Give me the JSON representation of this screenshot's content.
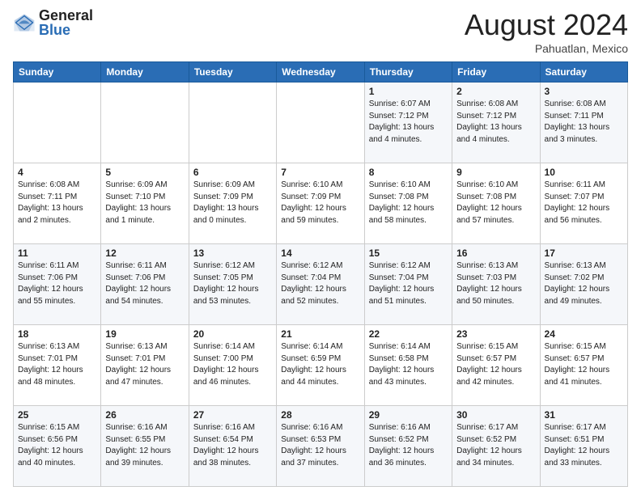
{
  "header": {
    "logo_general": "General",
    "logo_blue": "Blue",
    "main_title": "August 2024",
    "sub_title": "Pahuatlan, Mexico"
  },
  "calendar": {
    "days_of_week": [
      "Sunday",
      "Monday",
      "Tuesday",
      "Wednesday",
      "Thursday",
      "Friday",
      "Saturday"
    ],
    "weeks": [
      [
        {
          "day": "",
          "info": ""
        },
        {
          "day": "",
          "info": ""
        },
        {
          "day": "",
          "info": ""
        },
        {
          "day": "",
          "info": ""
        },
        {
          "day": "1",
          "info": "Sunrise: 6:07 AM\nSunset: 7:12 PM\nDaylight: 13 hours\nand 4 minutes."
        },
        {
          "day": "2",
          "info": "Sunrise: 6:08 AM\nSunset: 7:12 PM\nDaylight: 13 hours\nand 4 minutes."
        },
        {
          "day": "3",
          "info": "Sunrise: 6:08 AM\nSunset: 7:11 PM\nDaylight: 13 hours\nand 3 minutes."
        }
      ],
      [
        {
          "day": "4",
          "info": "Sunrise: 6:08 AM\nSunset: 7:11 PM\nDaylight: 13 hours\nand 2 minutes."
        },
        {
          "day": "5",
          "info": "Sunrise: 6:09 AM\nSunset: 7:10 PM\nDaylight: 13 hours\nand 1 minute."
        },
        {
          "day": "6",
          "info": "Sunrise: 6:09 AM\nSunset: 7:09 PM\nDaylight: 13 hours\nand 0 minutes."
        },
        {
          "day": "7",
          "info": "Sunrise: 6:10 AM\nSunset: 7:09 PM\nDaylight: 12 hours\nand 59 minutes."
        },
        {
          "day": "8",
          "info": "Sunrise: 6:10 AM\nSunset: 7:08 PM\nDaylight: 12 hours\nand 58 minutes."
        },
        {
          "day": "9",
          "info": "Sunrise: 6:10 AM\nSunset: 7:08 PM\nDaylight: 12 hours\nand 57 minutes."
        },
        {
          "day": "10",
          "info": "Sunrise: 6:11 AM\nSunset: 7:07 PM\nDaylight: 12 hours\nand 56 minutes."
        }
      ],
      [
        {
          "day": "11",
          "info": "Sunrise: 6:11 AM\nSunset: 7:06 PM\nDaylight: 12 hours\nand 55 minutes."
        },
        {
          "day": "12",
          "info": "Sunrise: 6:11 AM\nSunset: 7:06 PM\nDaylight: 12 hours\nand 54 minutes."
        },
        {
          "day": "13",
          "info": "Sunrise: 6:12 AM\nSunset: 7:05 PM\nDaylight: 12 hours\nand 53 minutes."
        },
        {
          "day": "14",
          "info": "Sunrise: 6:12 AM\nSunset: 7:04 PM\nDaylight: 12 hours\nand 52 minutes."
        },
        {
          "day": "15",
          "info": "Sunrise: 6:12 AM\nSunset: 7:04 PM\nDaylight: 12 hours\nand 51 minutes."
        },
        {
          "day": "16",
          "info": "Sunrise: 6:13 AM\nSunset: 7:03 PM\nDaylight: 12 hours\nand 50 minutes."
        },
        {
          "day": "17",
          "info": "Sunrise: 6:13 AM\nSunset: 7:02 PM\nDaylight: 12 hours\nand 49 minutes."
        }
      ],
      [
        {
          "day": "18",
          "info": "Sunrise: 6:13 AM\nSunset: 7:01 PM\nDaylight: 12 hours\nand 48 minutes."
        },
        {
          "day": "19",
          "info": "Sunrise: 6:13 AM\nSunset: 7:01 PM\nDaylight: 12 hours\nand 47 minutes."
        },
        {
          "day": "20",
          "info": "Sunrise: 6:14 AM\nSunset: 7:00 PM\nDaylight: 12 hours\nand 46 minutes."
        },
        {
          "day": "21",
          "info": "Sunrise: 6:14 AM\nSunset: 6:59 PM\nDaylight: 12 hours\nand 44 minutes."
        },
        {
          "day": "22",
          "info": "Sunrise: 6:14 AM\nSunset: 6:58 PM\nDaylight: 12 hours\nand 43 minutes."
        },
        {
          "day": "23",
          "info": "Sunrise: 6:15 AM\nSunset: 6:57 PM\nDaylight: 12 hours\nand 42 minutes."
        },
        {
          "day": "24",
          "info": "Sunrise: 6:15 AM\nSunset: 6:57 PM\nDaylight: 12 hours\nand 41 minutes."
        }
      ],
      [
        {
          "day": "25",
          "info": "Sunrise: 6:15 AM\nSunset: 6:56 PM\nDaylight: 12 hours\nand 40 minutes."
        },
        {
          "day": "26",
          "info": "Sunrise: 6:16 AM\nSunset: 6:55 PM\nDaylight: 12 hours\nand 39 minutes."
        },
        {
          "day": "27",
          "info": "Sunrise: 6:16 AM\nSunset: 6:54 PM\nDaylight: 12 hours\nand 38 minutes."
        },
        {
          "day": "28",
          "info": "Sunrise: 6:16 AM\nSunset: 6:53 PM\nDaylight: 12 hours\nand 37 minutes."
        },
        {
          "day": "29",
          "info": "Sunrise: 6:16 AM\nSunset: 6:52 PM\nDaylight: 12 hours\nand 36 minutes."
        },
        {
          "day": "30",
          "info": "Sunrise: 6:17 AM\nSunset: 6:52 PM\nDaylight: 12 hours\nand 34 minutes."
        },
        {
          "day": "31",
          "info": "Sunrise: 6:17 AM\nSunset: 6:51 PM\nDaylight: 12 hours\nand 33 minutes."
        }
      ]
    ]
  }
}
